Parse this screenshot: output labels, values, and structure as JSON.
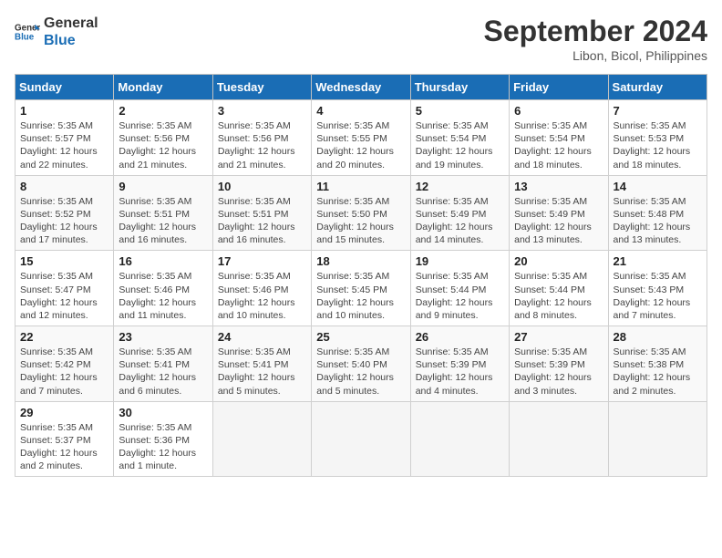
{
  "header": {
    "logo_line1": "General",
    "logo_line2": "Blue",
    "month": "September 2024",
    "location": "Libon, Bicol, Philippines"
  },
  "weekdays": [
    "Sunday",
    "Monday",
    "Tuesday",
    "Wednesday",
    "Thursday",
    "Friday",
    "Saturday"
  ],
  "weeks": [
    [
      {
        "day": "1",
        "info": "Sunrise: 5:35 AM\nSunset: 5:57 PM\nDaylight: 12 hours\nand 22 minutes."
      },
      {
        "day": "2",
        "info": "Sunrise: 5:35 AM\nSunset: 5:56 PM\nDaylight: 12 hours\nand 21 minutes."
      },
      {
        "day": "3",
        "info": "Sunrise: 5:35 AM\nSunset: 5:56 PM\nDaylight: 12 hours\nand 21 minutes."
      },
      {
        "day": "4",
        "info": "Sunrise: 5:35 AM\nSunset: 5:55 PM\nDaylight: 12 hours\nand 20 minutes."
      },
      {
        "day": "5",
        "info": "Sunrise: 5:35 AM\nSunset: 5:54 PM\nDaylight: 12 hours\nand 19 minutes."
      },
      {
        "day": "6",
        "info": "Sunrise: 5:35 AM\nSunset: 5:54 PM\nDaylight: 12 hours\nand 18 minutes."
      },
      {
        "day": "7",
        "info": "Sunrise: 5:35 AM\nSunset: 5:53 PM\nDaylight: 12 hours\nand 18 minutes."
      }
    ],
    [
      {
        "day": "8",
        "info": "Sunrise: 5:35 AM\nSunset: 5:52 PM\nDaylight: 12 hours\nand 17 minutes."
      },
      {
        "day": "9",
        "info": "Sunrise: 5:35 AM\nSunset: 5:51 PM\nDaylight: 12 hours\nand 16 minutes."
      },
      {
        "day": "10",
        "info": "Sunrise: 5:35 AM\nSunset: 5:51 PM\nDaylight: 12 hours\nand 16 minutes."
      },
      {
        "day": "11",
        "info": "Sunrise: 5:35 AM\nSunset: 5:50 PM\nDaylight: 12 hours\nand 15 minutes."
      },
      {
        "day": "12",
        "info": "Sunrise: 5:35 AM\nSunset: 5:49 PM\nDaylight: 12 hours\nand 14 minutes."
      },
      {
        "day": "13",
        "info": "Sunrise: 5:35 AM\nSunset: 5:49 PM\nDaylight: 12 hours\nand 13 minutes."
      },
      {
        "day": "14",
        "info": "Sunrise: 5:35 AM\nSunset: 5:48 PM\nDaylight: 12 hours\nand 13 minutes."
      }
    ],
    [
      {
        "day": "15",
        "info": "Sunrise: 5:35 AM\nSunset: 5:47 PM\nDaylight: 12 hours\nand 12 minutes."
      },
      {
        "day": "16",
        "info": "Sunrise: 5:35 AM\nSunset: 5:46 PM\nDaylight: 12 hours\nand 11 minutes."
      },
      {
        "day": "17",
        "info": "Sunrise: 5:35 AM\nSunset: 5:46 PM\nDaylight: 12 hours\nand 10 minutes."
      },
      {
        "day": "18",
        "info": "Sunrise: 5:35 AM\nSunset: 5:45 PM\nDaylight: 12 hours\nand 10 minutes."
      },
      {
        "day": "19",
        "info": "Sunrise: 5:35 AM\nSunset: 5:44 PM\nDaylight: 12 hours\nand 9 minutes."
      },
      {
        "day": "20",
        "info": "Sunrise: 5:35 AM\nSunset: 5:44 PM\nDaylight: 12 hours\nand 8 minutes."
      },
      {
        "day": "21",
        "info": "Sunrise: 5:35 AM\nSunset: 5:43 PM\nDaylight: 12 hours\nand 7 minutes."
      }
    ],
    [
      {
        "day": "22",
        "info": "Sunrise: 5:35 AM\nSunset: 5:42 PM\nDaylight: 12 hours\nand 7 minutes."
      },
      {
        "day": "23",
        "info": "Sunrise: 5:35 AM\nSunset: 5:41 PM\nDaylight: 12 hours\nand 6 minutes."
      },
      {
        "day": "24",
        "info": "Sunrise: 5:35 AM\nSunset: 5:41 PM\nDaylight: 12 hours\nand 5 minutes."
      },
      {
        "day": "25",
        "info": "Sunrise: 5:35 AM\nSunset: 5:40 PM\nDaylight: 12 hours\nand 5 minutes."
      },
      {
        "day": "26",
        "info": "Sunrise: 5:35 AM\nSunset: 5:39 PM\nDaylight: 12 hours\nand 4 minutes."
      },
      {
        "day": "27",
        "info": "Sunrise: 5:35 AM\nSunset: 5:39 PM\nDaylight: 12 hours\nand 3 minutes."
      },
      {
        "day": "28",
        "info": "Sunrise: 5:35 AM\nSunset: 5:38 PM\nDaylight: 12 hours\nand 2 minutes."
      }
    ],
    [
      {
        "day": "29",
        "info": "Sunrise: 5:35 AM\nSunset: 5:37 PM\nDaylight: 12 hours\nand 2 minutes."
      },
      {
        "day": "30",
        "info": "Sunrise: 5:35 AM\nSunset: 5:36 PM\nDaylight: 12 hours\nand 1 minute."
      },
      {
        "day": "",
        "info": ""
      },
      {
        "day": "",
        "info": ""
      },
      {
        "day": "",
        "info": ""
      },
      {
        "day": "",
        "info": ""
      },
      {
        "day": "",
        "info": ""
      }
    ]
  ]
}
